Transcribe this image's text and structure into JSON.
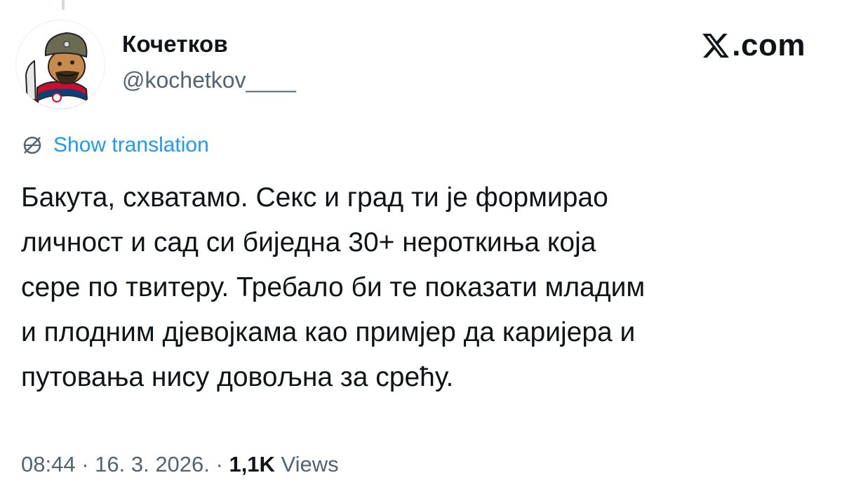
{
  "author": {
    "display_name": "Кочетков",
    "handle": "@kochetkov____",
    "avatar_icon": "cartoon-soldier-avatar"
  },
  "brand": {
    "label": ".com",
    "logo_icon": "x-logo-icon"
  },
  "translation": {
    "label": "Show translation",
    "icon": "globe-icon",
    "color": "#1d9bf0"
  },
  "tweet": {
    "lines": [
      "Бакута, схватамо. Секс и град ти је формирао",
      "личност и сад си биједна 30+ нероткиња која",
      "сере по твитеру. Требало би те показати младим",
      "и плодним дјевојкама као примјер да каријера и",
      "путовања нису довољна за срећу."
    ]
  },
  "meta": {
    "time": "08:44",
    "separator": " · ",
    "date": "16. 3. 2026.",
    "views_count": "1,1K",
    "views_label": " Views"
  },
  "colors": {
    "text": "#0f1419",
    "muted": "#536471",
    "accent": "#1d9bf0"
  }
}
